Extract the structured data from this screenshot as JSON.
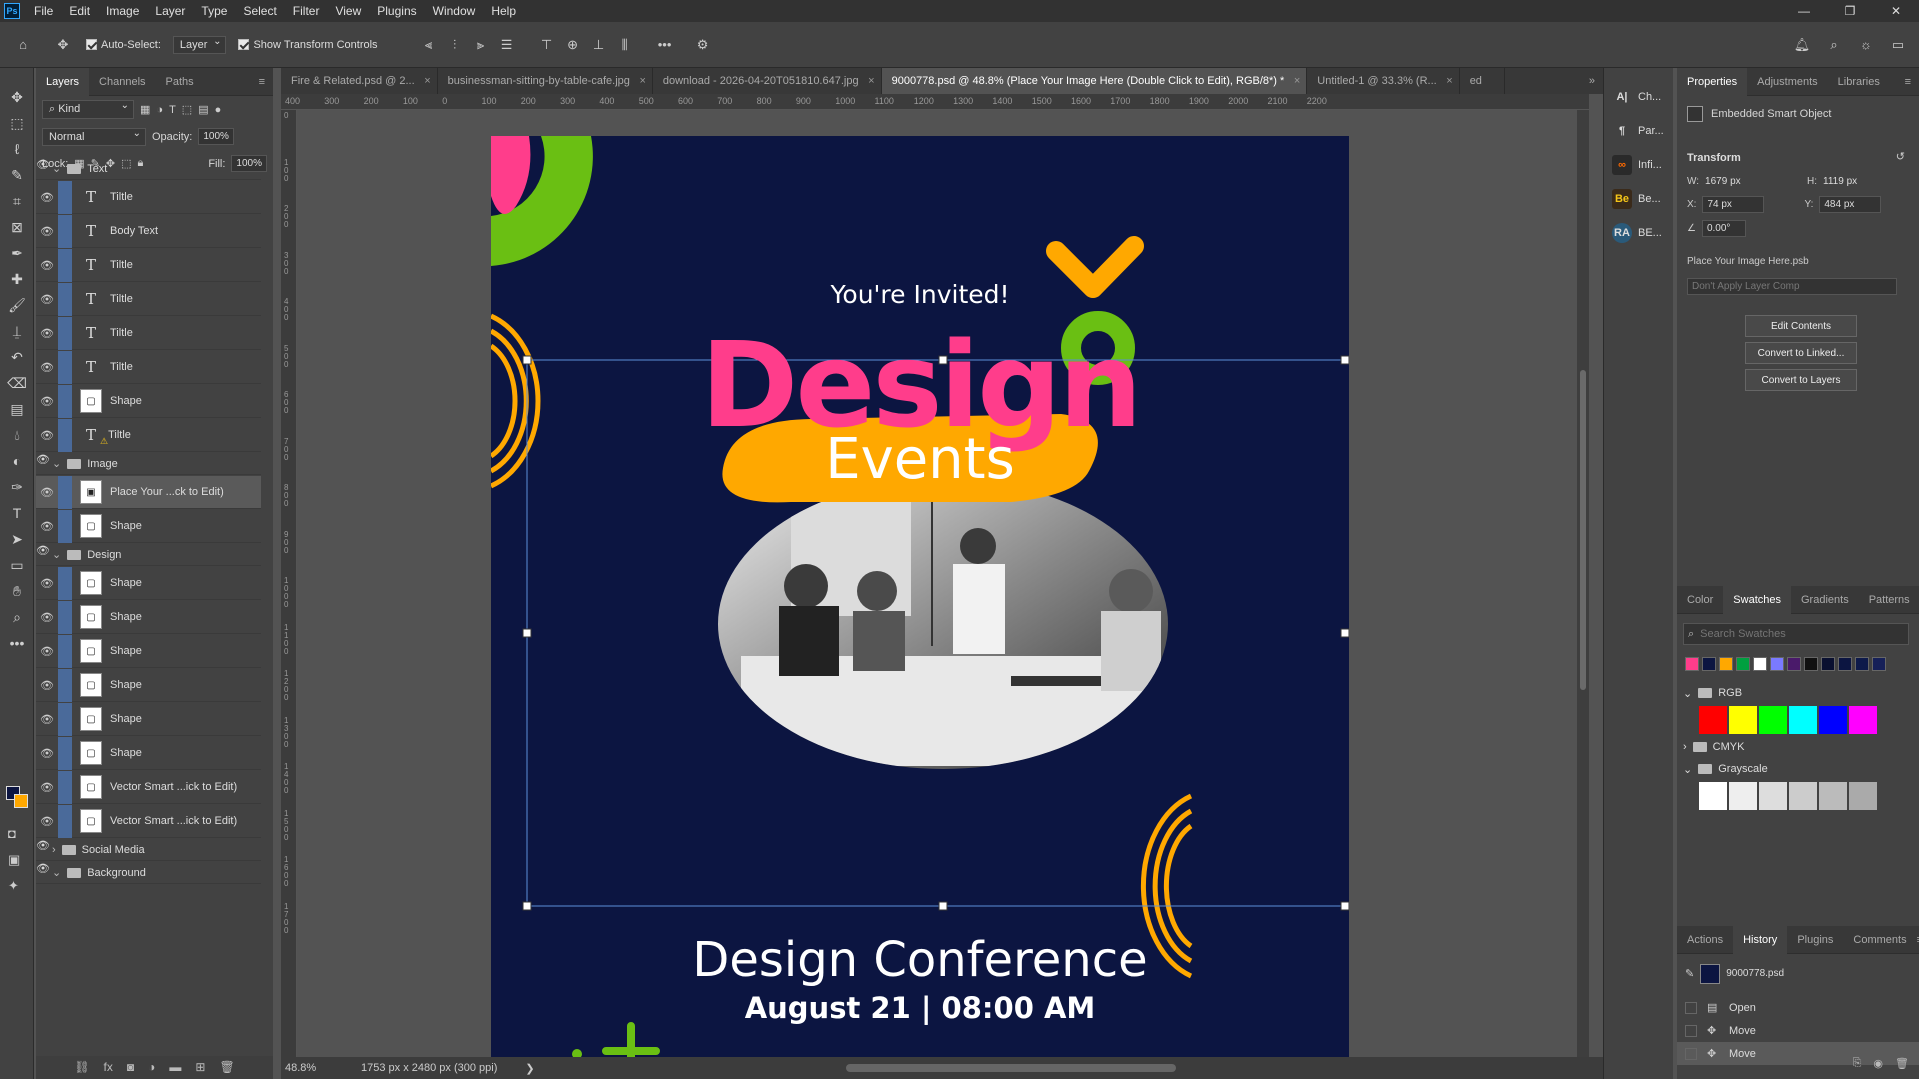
{
  "app": {
    "logo": "Ps",
    "menu": [
      "File",
      "Edit",
      "Image",
      "Layer",
      "Type",
      "Select",
      "Filter",
      "View",
      "Plugins",
      "Window",
      "Help"
    ],
    "window_controls": [
      "—",
      "❐",
      "✕"
    ]
  },
  "options_bar": {
    "auto_select_label": "Auto-Select:",
    "auto_select_target": "Layer",
    "show_transform_label": "Show Transform Controls",
    "more_icon": "•••"
  },
  "tools": [
    "move-tool",
    "marquee-tool",
    "lasso-tool",
    "quick-select-tool",
    "crop-tool",
    "frame-tool",
    "eyedropper-tool",
    "healing-tool",
    "brush-tool",
    "stamp-tool",
    "history-brush-tool",
    "eraser-tool",
    "gradient-tool",
    "blur-tool",
    "dodge-tool",
    "pen-tool",
    "type-tool",
    "path-select-tool",
    "rectangle-tool",
    "hand-tool",
    "zoom-tool",
    "more-tools"
  ],
  "layers_panel": {
    "tabs": [
      "Layers",
      "Channels",
      "Paths"
    ],
    "filter_kind": "Kind",
    "blend_mode": "Normal",
    "opacity_label": "Opacity:",
    "opacity_value": "100%",
    "lock_label": "Lock:",
    "fill_label": "Fill:",
    "fill_value": "100%",
    "rows": [
      {
        "kind": "group",
        "name": "Text"
      },
      {
        "kind": "type",
        "name": "Tiltle"
      },
      {
        "kind": "type",
        "name": "Body Text"
      },
      {
        "kind": "type",
        "name": "Tiltle"
      },
      {
        "kind": "type",
        "name": "Tiltle"
      },
      {
        "kind": "type",
        "name": "Tiltle"
      },
      {
        "kind": "type",
        "name": "Tiltle"
      },
      {
        "kind": "shape",
        "name": "Shape"
      },
      {
        "kind": "type-warn",
        "name": "Tiltle"
      },
      {
        "kind": "group",
        "name": "Image"
      },
      {
        "kind": "smart",
        "name": "Place Your ...ck to Edit)",
        "selected": true
      },
      {
        "kind": "shape",
        "name": "Shape"
      },
      {
        "kind": "group",
        "name": "Design"
      },
      {
        "kind": "shape",
        "name": "Shape"
      },
      {
        "kind": "shape",
        "name": "Shape"
      },
      {
        "kind": "shape",
        "name": "Shape"
      },
      {
        "kind": "shape",
        "name": "Shape"
      },
      {
        "kind": "shape",
        "name": "Shape"
      },
      {
        "kind": "shape",
        "name": "Shape"
      },
      {
        "kind": "shape",
        "name": "Vector Smart ...ick to Edit)"
      },
      {
        "kind": "shape",
        "name": "Vector Smart ...ick to Edit)"
      },
      {
        "kind": "group-closed",
        "name": "Social Media"
      },
      {
        "kind": "group",
        "name": "Background"
      }
    ],
    "footer_icons": [
      "link-icon",
      "fx-icon",
      "mask-icon",
      "adjustment-icon",
      "folder-icon",
      "new-layer-icon",
      "trash-icon"
    ]
  },
  "document_tabs": [
    {
      "label": "Fire & Related.psd @ 2...",
      "active": false
    },
    {
      "label": "businessman-sitting-by-table-cafe.jpg",
      "active": false
    },
    {
      "label": "download - 2026-04-20T051810.647.jpg",
      "active": false
    },
    {
      "label": "9000778.psd @ 48.8% (Place Your Image Here (Double Click to Edit), RGB/8*) *",
      "active": true
    },
    {
      "label": "Untitled-1 @ 33.3% (R...",
      "active": false
    },
    {
      "label": "ed",
      "active": false
    }
  ],
  "ruler": {
    "h_ticks": [
      "400",
      "300",
      "200",
      "100",
      "0",
      "100",
      "200",
      "300",
      "400",
      "500",
      "600",
      "700",
      "800",
      "900",
      "1000",
      "1100",
      "1200",
      "1300",
      "1400",
      "1500",
      "1600",
      "1700",
      "1800",
      "1900",
      "2000",
      "2100",
      "2200"
    ],
    "v_ticks": [
      "0",
      "1\n0\n0",
      "2\n0\n0",
      "3\n0\n0",
      "4\n0\n0",
      "5\n0\n0",
      "6\n0\n0",
      "7\n0\n0",
      "8\n0\n0",
      "9\n0\n0",
      "1\n0\n0\n0",
      "1\n1\n0\n0",
      "1\n2\n0\n0",
      "1\n3\n0\n0",
      "1\n4\n0\n0",
      "1\n5\n0\n0",
      "1\n6\n0\n0",
      "1\n7\n0\n0"
    ]
  },
  "poster": {
    "invite": "You're Invited!",
    "headline": "Design",
    "subhead": "Events",
    "conference": "Design Conference",
    "date": "August 21 | 08:00 AM",
    "colors": {
      "bg": "#0c1541",
      "pink": "#ff3d8b",
      "green": "#6abf13",
      "orange": "#ffa800",
      "white": "#ffffff"
    }
  },
  "status": {
    "zoom": "48.8%",
    "doc_info": "1753 px x 2480 px (300 ppi)",
    "arrow": "❯"
  },
  "mini_panel": [
    {
      "icon": "A|",
      "label": "Ch..."
    },
    {
      "icon": "¶",
      "label": "Par..."
    },
    {
      "icon": "∞",
      "label": "Infi..."
    },
    {
      "icon": "Be",
      "label": "Be..."
    },
    {
      "icon": "RA",
      "label": "BE..."
    }
  ],
  "properties": {
    "tabs": [
      "Properties",
      "Adjustments",
      "Libraries"
    ],
    "object_type": "Embedded Smart Object",
    "transform_label": "Transform",
    "w_label": "W:",
    "w_value": "1679 px",
    "h_label": "H:",
    "h_value": "1119 px",
    "x_label": "X:",
    "x_value": "74 px",
    "y_label": "Y:",
    "y_value": "484 px",
    "angle_value": "0.00°",
    "file_name": "Place Your Image Here.psb",
    "layer_comp_placeholder": "Don't Apply Layer Comp",
    "buttons": [
      "Edit Contents",
      "Convert to Linked...",
      "Convert to Layers"
    ]
  },
  "swatches_panel": {
    "tabs": [
      "Color",
      "Swatches",
      "Gradients",
      "Patterns"
    ],
    "search_placeholder": "Search Swatches",
    "recent": [
      "#ff3d8b",
      "#0c1541",
      "#ffa800",
      "#00a040",
      "#ffffff",
      "#7a7aff",
      "#4a1a6a",
      "#111111",
      "#0a1030",
      "#0c1541",
      "#0e1a4a",
      "#162058"
    ],
    "groups": [
      {
        "name": "RGB",
        "open": true,
        "colors": [
          "#ff0000",
          "#ffff00",
          "#00ff00",
          "#00ffff",
          "#0000ff",
          "#ff00ff"
        ]
      },
      {
        "name": "CMYK",
        "open": false,
        "colors": []
      },
      {
        "name": "Grayscale",
        "open": true,
        "colors": [
          "#ffffff",
          "#eeeeee",
          "#dddddd",
          "#cccccc",
          "#bbbbbb",
          "#aaaaaa"
        ]
      }
    ]
  },
  "history_panel": {
    "tabs": [
      "Actions",
      "History",
      "Plugins",
      "Comments"
    ],
    "snapshot": "9000778.psd",
    "steps": [
      "Open",
      "Move",
      "Move"
    ]
  }
}
